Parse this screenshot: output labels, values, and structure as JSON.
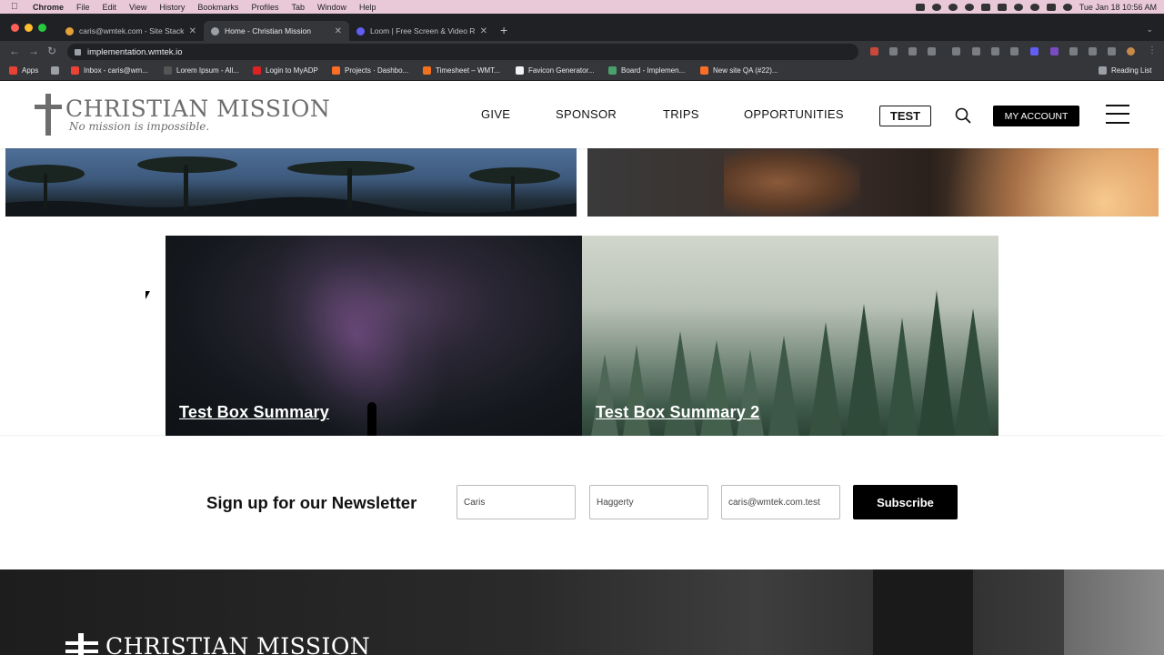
{
  "mac_menubar": {
    "app": "Chrome",
    "items": [
      "File",
      "Edit",
      "View",
      "History",
      "Bookmarks",
      "Profiles",
      "Tab",
      "Window",
      "Help"
    ],
    "datetime": "Tue Jan 18  10:56 AM"
  },
  "browser": {
    "tabs": [
      {
        "title": "caris@wmtek.com - Site Stack",
        "active": false
      },
      {
        "title": "Home - Christian Mission",
        "active": true
      },
      {
        "title": "Loom | Free Screen & Video Re",
        "active": false
      }
    ],
    "url": "implementation.wmtek.io",
    "bookmarks": [
      "Apps",
      "Inbox - caris@wm...",
      "Lorem Ipsum - All...",
      "Login to MyADP",
      "Projects · Dashbo...",
      "Timesheet – WMT...",
      "Favicon Generator...",
      "Board - Implemen...",
      "New site QA (#22)..."
    ],
    "reading_list": "Reading List"
  },
  "site": {
    "logo": {
      "name": "CHRISTIAN MISSION",
      "tagline": "No mission is impossible."
    },
    "nav": [
      "GIVE",
      "SPONSOR",
      "TRIPS",
      "OPPORTUNITIES"
    ],
    "test_button": "TEST",
    "account_button": "MY ACCOUNT"
  },
  "boxes": [
    {
      "title": "Test Box Summary"
    },
    {
      "title": "Test Box Summary 2"
    }
  ],
  "newsletter": {
    "title": "Sign up for our Newsletter",
    "first_name": "Caris",
    "last_name": "Haggerty",
    "email": "caris@wmtek.com.test",
    "button": "Subscribe"
  },
  "footer": {
    "logo_name": "CHRISTIAN MISSION"
  }
}
